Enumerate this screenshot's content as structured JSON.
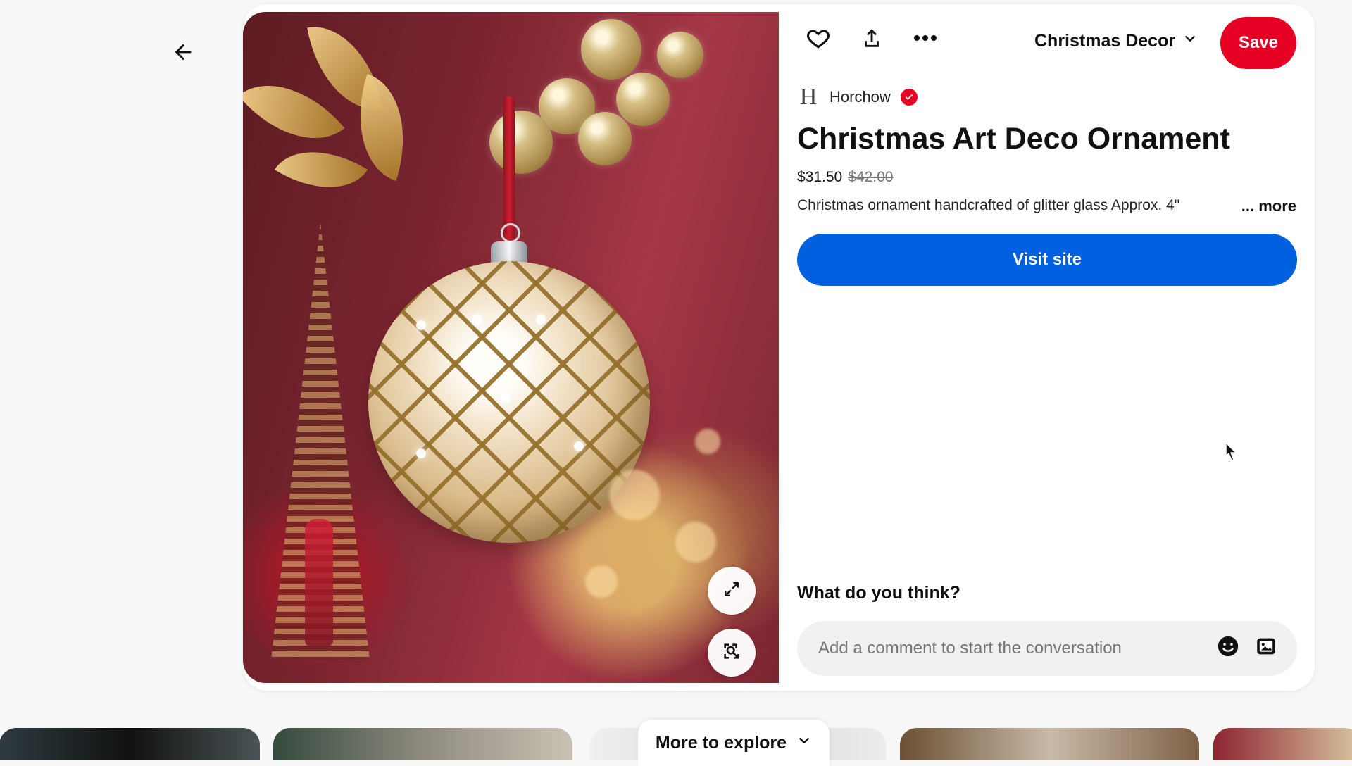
{
  "navigation": {
    "back_icon": "arrow-left-icon"
  },
  "pin": {
    "image_label": "Christmas ornament image",
    "creator": {
      "avatar_letter": "H",
      "name": "Horchow",
      "verified_icon": "check-badge-icon"
    },
    "title": "Christmas Art Deco Ornament",
    "price": "$31.50",
    "original_price": "$42.00",
    "description": "Christmas ornament handcrafted of glitter glass Approx. 4\"",
    "more_label": "... more",
    "visit_site_label": "Visit site"
  },
  "actions": {
    "like_icon": "heart-icon",
    "share_icon": "share-icon",
    "more_icon": "more-icon",
    "board_label": "Christmas Decor",
    "board_dropdown_icon": "chevron-down-icon",
    "save_label": "Save"
  },
  "media_controls": {
    "expand_icon": "expand-icon",
    "visual_search_icon": "lens-search-icon"
  },
  "comments": {
    "heading": "What do you think?",
    "placeholder": "Add a comment to start the conversation",
    "emoji_icon": "emoji-icon",
    "image_icon": "image-icon"
  },
  "explore": {
    "label": "More to explore",
    "dropdown_icon": "chevron-down-icon"
  },
  "colors": {
    "save": "#e60023",
    "visit": "#0060df",
    "background": "#f7f7f8"
  }
}
